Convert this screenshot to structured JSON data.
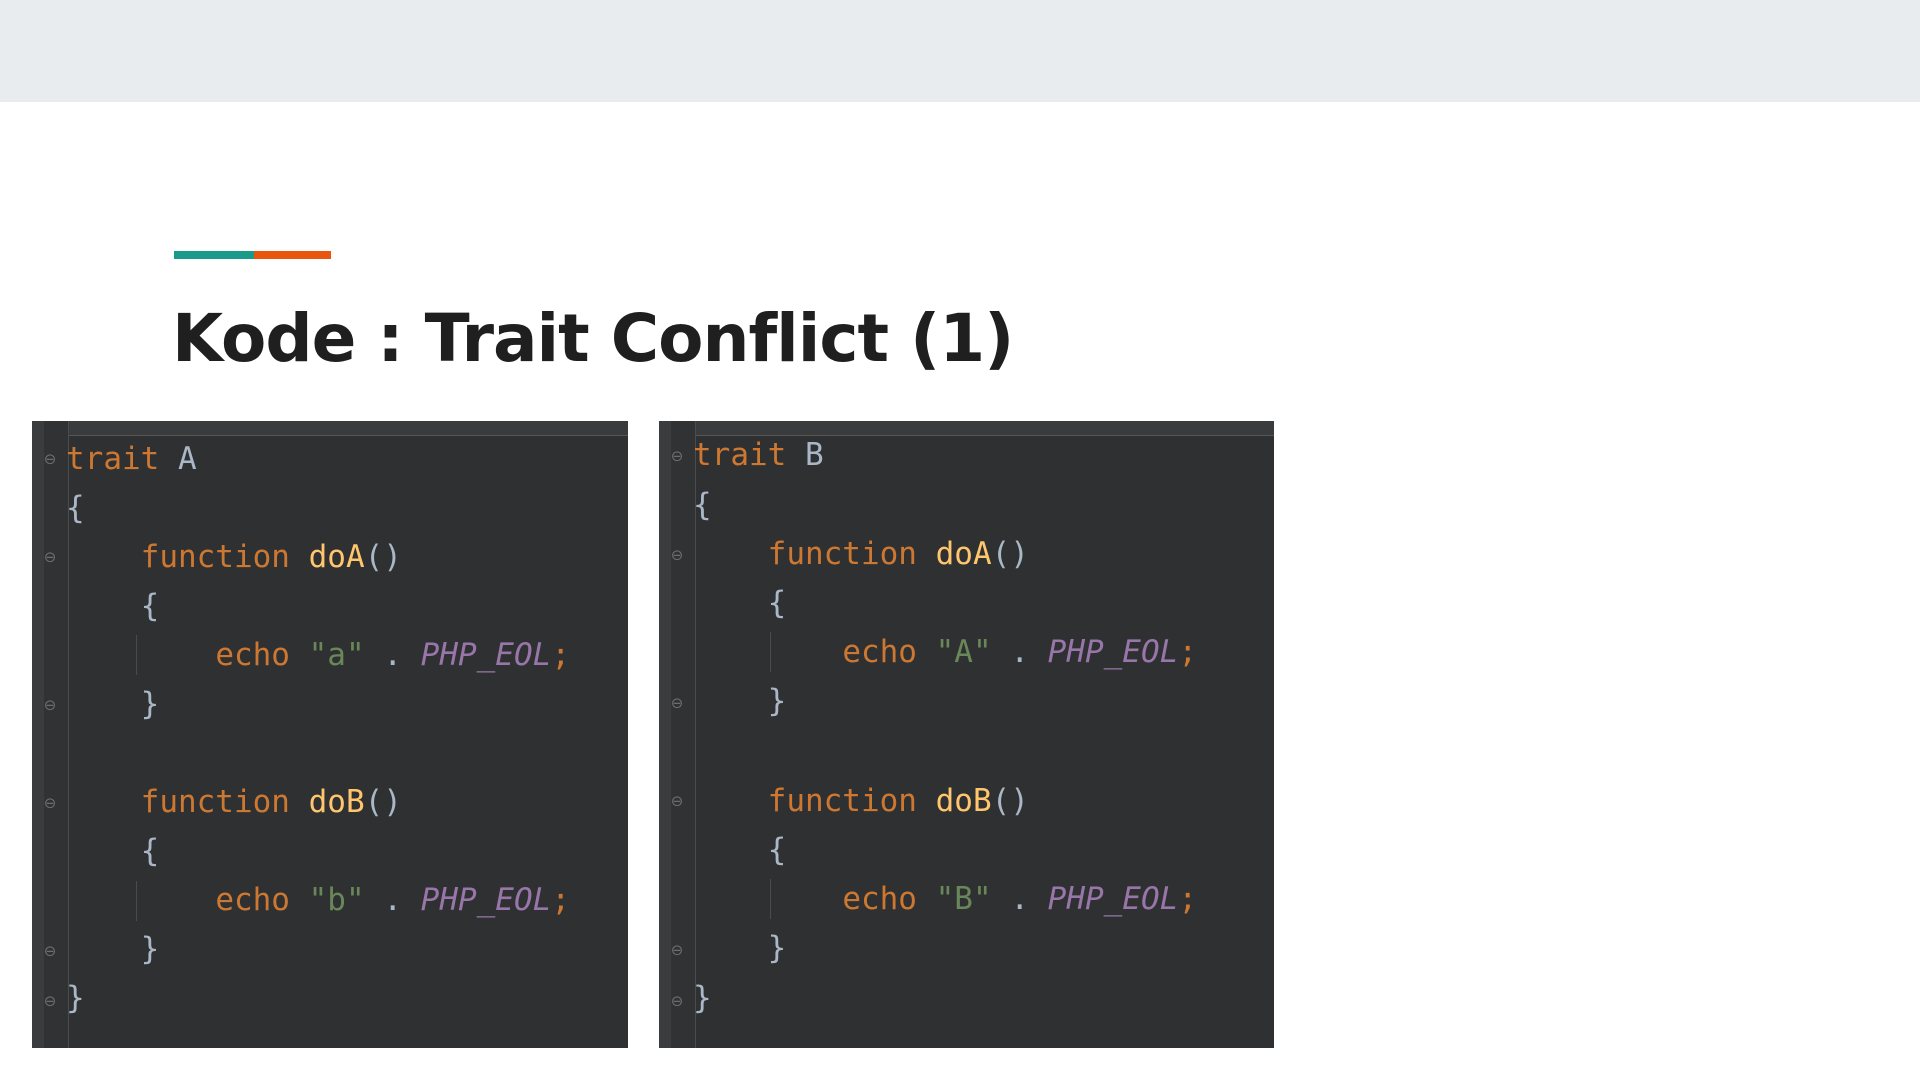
{
  "slide": {
    "title": "Kode : Trait Conflict (1)",
    "accent_colors": [
      "#1a9a8a",
      "#e8550f"
    ]
  },
  "panels": [
    {
      "keyword": "trait",
      "name": "A",
      "open_brace": "{",
      "close_brace": "}",
      "methods": [
        {
          "keyword": "function",
          "name": "doA",
          "parens": "()",
          "open_brace": "{",
          "echo": "echo",
          "string": "\"a\"",
          "dot": ".",
          "const": "PHP_EOL",
          "semicolon": ";",
          "close_brace": "}"
        },
        {
          "keyword": "function",
          "name": "doB",
          "parens": "()",
          "open_brace": "{",
          "echo": "echo",
          "string": "\"b\"",
          "dot": ".",
          "const": "PHP_EOL",
          "semicolon": ";",
          "close_brace": "}"
        }
      ]
    },
    {
      "keyword": "trait",
      "name": "B",
      "open_brace": "{",
      "close_brace": "}",
      "methods": [
        {
          "keyword": "function",
          "name": "doA",
          "parens": "()",
          "open_brace": "{",
          "echo": "echo",
          "string": "\"A\"",
          "dot": ".",
          "const": "PHP_EOL",
          "semicolon": ";",
          "close_brace": "}"
        },
        {
          "keyword": "function",
          "name": "doB",
          "parens": "()",
          "open_brace": "{",
          "echo": "echo",
          "string": "\"B\"",
          "dot": ".",
          "const": "PHP_EOL",
          "semicolon": ";",
          "close_brace": "}"
        }
      ]
    }
  ],
  "editor_colors": {
    "background": "#2f3031",
    "keyword": "#cc7832",
    "function_name": "#ffc66d",
    "string": "#6a8759",
    "constant": "#9876aa",
    "plain": "#a9b7c6"
  }
}
